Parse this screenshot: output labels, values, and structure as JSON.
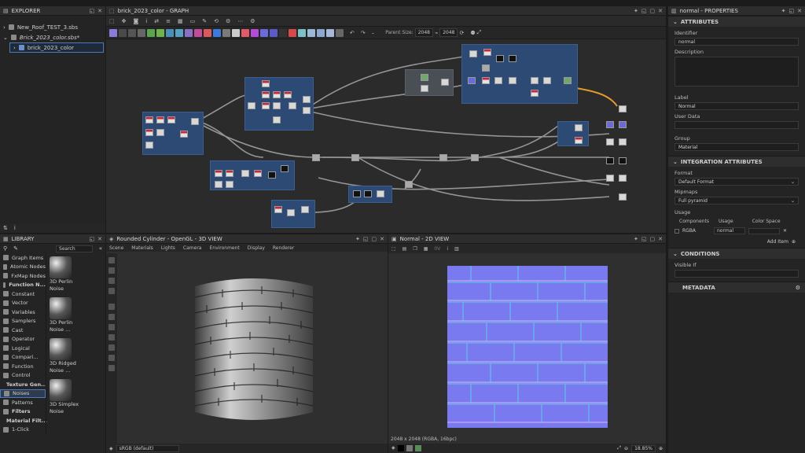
{
  "explorer": {
    "title": "EXPLORER",
    "items": [
      {
        "label": "New_Roof_TEST_3.sbs"
      },
      {
        "label": "Brick_2023_color.sbs*"
      },
      {
        "label": "brick_2023_color"
      }
    ]
  },
  "graph": {
    "title": "brick_2023_color - GRAPH",
    "parent_size_label": "Parent Size:",
    "parent_size": "2048",
    "size_value": "2048"
  },
  "properties": {
    "title": "normal - PROPERTIES",
    "sections": {
      "attributes": "ATTRIBUTES",
      "integration": "INTEGRATION ATTRIBUTES",
      "conditions": "CONDITIONS",
      "metadata": "METADATA"
    },
    "identifier_label": "Identifier",
    "identifier_value": "normal",
    "description_label": "Description",
    "label_label": "Label",
    "label_value": "Normal",
    "userdata_label": "User Data",
    "group_label": "Group",
    "group_value": "Material",
    "format_label": "Format",
    "format_value": "Default Format",
    "mipmaps_label": "Mipmaps",
    "mipmaps_value": "Full pyramid",
    "usage_label": "Usage",
    "components_label": "Components",
    "usage_col_label": "Usage",
    "colorspace_label": "Color Space",
    "components_value": "RGBA",
    "usage_value": "normal",
    "add_item": "Add Item",
    "visible_if_label": "Visible If"
  },
  "library": {
    "title": "LIBRARY",
    "search_placeholder": "Search",
    "items": [
      {
        "label": "Graph Items",
        "hdr": false
      },
      {
        "label": "Atomic Nodes",
        "hdr": false
      },
      {
        "label": "FxMap Nodes",
        "hdr": false
      },
      {
        "label": "Function N...",
        "hdr": true
      },
      {
        "label": "Constant",
        "hdr": false
      },
      {
        "label": "Vector",
        "hdr": false
      },
      {
        "label": "Variables",
        "hdr": false
      },
      {
        "label": "Samplers",
        "hdr": false
      },
      {
        "label": "Cast",
        "hdr": false
      },
      {
        "label": "Operator",
        "hdr": false
      },
      {
        "label": "Logical",
        "hdr": false
      },
      {
        "label": "Compari...",
        "hdr": false
      },
      {
        "label": "Function",
        "hdr": false
      },
      {
        "label": "Control",
        "hdr": false
      },
      {
        "label": "Texture Gen...",
        "hdr": true
      },
      {
        "label": "Noises",
        "hdr": false
      },
      {
        "label": "Patterns",
        "hdr": false
      },
      {
        "label": "Filters",
        "hdr": true
      },
      {
        "label": "Material Filt...",
        "hdr": true
      },
      {
        "label": "1-Click",
        "hdr": false
      }
    ],
    "noises": [
      {
        "line1": "3D Perlin",
        "line2": "Noise"
      },
      {
        "line1": "3D Perlin",
        "line2": "Noise ..."
      },
      {
        "line1": "3D Ridged",
        "line2": "Noise ..."
      },
      {
        "line1": "3D Simplex",
        "line2": "Noise"
      }
    ]
  },
  "view3d": {
    "title": "Rounded Cylinder - OpenGL - 3D VIEW",
    "menu": [
      "Scene",
      "Materials",
      "Lights",
      "Camera",
      "Environment",
      "Display",
      "Renderer"
    ],
    "colorspace": "sRGB (default)"
  },
  "view2d": {
    "title": "Normal - 2D VIEW",
    "channel": "0V",
    "info": "2048 x 2048 (RGBA, 16bpc)",
    "zoom": "18.85%"
  }
}
